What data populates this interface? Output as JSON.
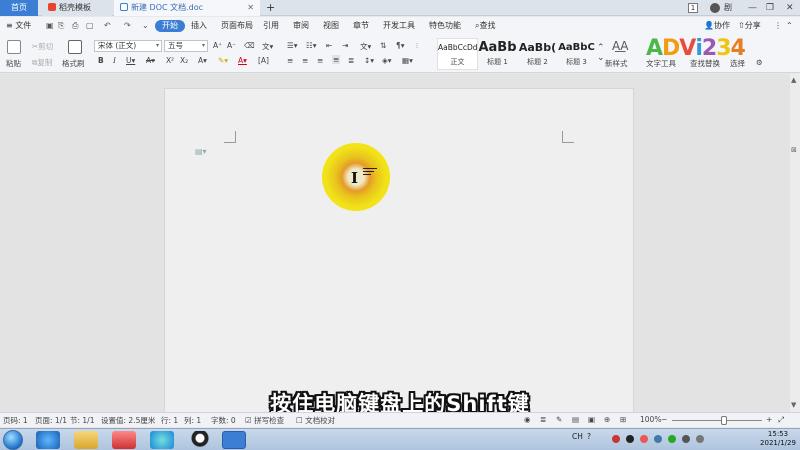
{
  "tabs": {
    "home": "首页",
    "template": "稻壳模板",
    "document": "新建 DOC 文档.doc",
    "close": "✕",
    "plus": "+",
    "badge": "1",
    "user": "剧"
  },
  "window_controls": [
    "—",
    "❐",
    "✕"
  ],
  "menu": {
    "file": "文件",
    "start": "开始",
    "items": [
      "插入",
      "页面布局",
      "引用",
      "审阅",
      "视图",
      "章节",
      "开发工具",
      "特色功能"
    ],
    "search": "查找",
    "collab": "协作",
    "share": "分享"
  },
  "ribbon": {
    "paste": "粘贴",
    "cut": "剪切",
    "copy": "复制",
    "format_painter": "格式刷",
    "font_name": "宋体 (正文)",
    "font_size": "五号",
    "styles": [
      {
        "preview": "AaBbCcDd",
        "name": "正文"
      },
      {
        "preview": "AaBb",
        "name": "标题 1"
      },
      {
        "preview": "AaBb(",
        "name": "标题 2"
      },
      {
        "preview": "AaBbC",
        "name": "标题 3"
      }
    ],
    "new_style": "新样式",
    "text_tools": "文字工具",
    "find_replace": "查找替换",
    "select": "选择"
  },
  "logo": {
    "text": "ADVi234",
    "colors": [
      "#4db84a",
      "#f39c12",
      "#e74c3c",
      "#3498db",
      "#9b59b6",
      "#f1c40f",
      "#e67e22"
    ]
  },
  "subtitle": "按住电脑键盘上的Shift键",
  "statusbar": {
    "page_num": "页码: 1",
    "pages": "页面: 1/1",
    "section": "节: 1/1",
    "setting": "设置值: 2.5厘米",
    "row": "行: 1",
    "col": "列: 1",
    "words": "字数: 0",
    "spell": "拼写检查",
    "proof": "文档校对",
    "zoom": "100%",
    "zoom_level": 0.58
  },
  "taskbar": {
    "ime": "CH",
    "time": "15:53",
    "date": "2021/1/29"
  }
}
